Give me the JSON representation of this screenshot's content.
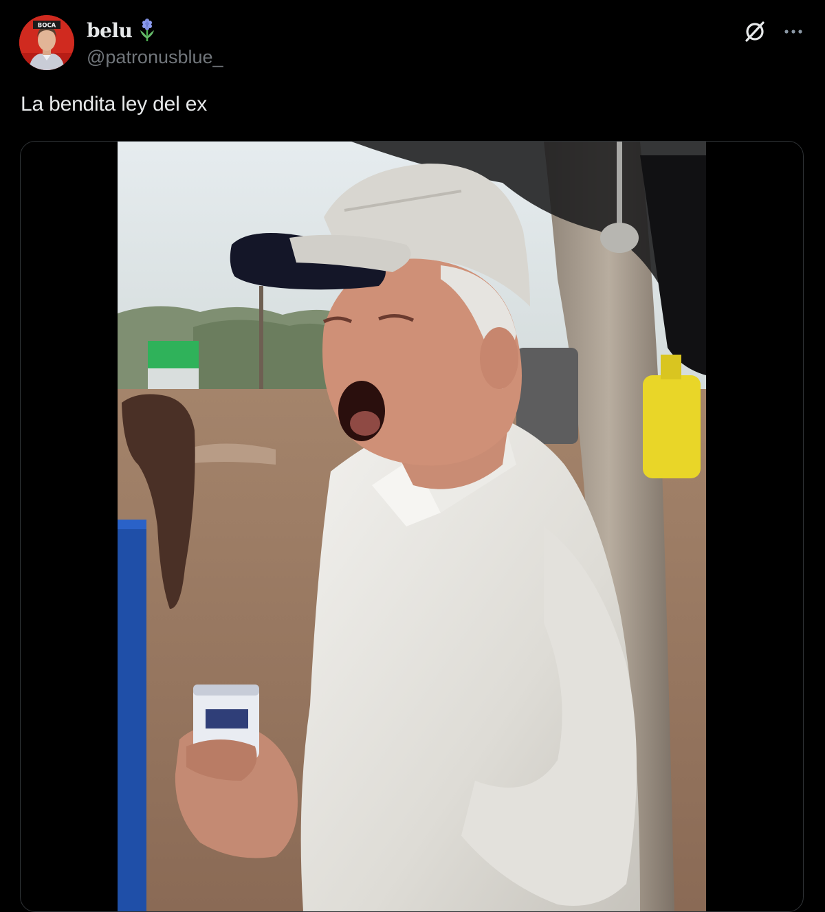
{
  "post": {
    "author": {
      "display_name": "belu",
      "handle": "@patronusblue_",
      "name_emoji_icon": "hyacinth-flower-icon",
      "avatar_text": "BOCA"
    },
    "text": "La bendita ley del ex",
    "media": {
      "type": "video",
      "description_icon": "video-still"
    }
  },
  "toolbar": {
    "grok_icon": "grok-icon",
    "more_icon": "more-options-icon"
  },
  "colors": {
    "background": "#000000",
    "primary_text": "#e7e9ea",
    "secondary_text": "#71767b",
    "border": "#2f3336"
  }
}
